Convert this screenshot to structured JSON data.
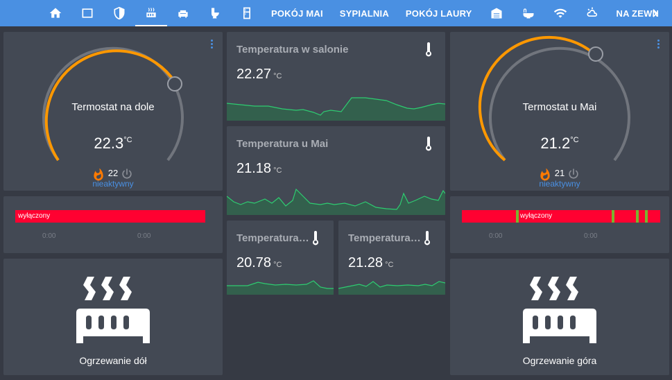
{
  "nav": {
    "tabs": [
      {
        "icon": "home-icon"
      },
      {
        "icon": "tv-icon"
      },
      {
        "icon": "shield-icon"
      },
      {
        "icon": "radiator-icon",
        "active": true
      },
      {
        "icon": "sofa-icon"
      },
      {
        "icon": "toilet-icon"
      },
      {
        "icon": "fridge-icon"
      }
    ],
    "text_tabs": [
      "POKÓJ MAI",
      "SYPIALNIA",
      "POKÓJ LAURY"
    ],
    "icon_tabs2": [
      {
        "icon": "garage-icon"
      },
      {
        "icon": "bathtub-icon"
      },
      {
        "icon": "wifi-icon"
      },
      {
        "icon": "weather-icon"
      }
    ],
    "last_tab": "NA ZEWN",
    "more_icon": "chevron-right-icon"
  },
  "thermostat_left": {
    "name": "Termostat na dole",
    "current": "22.3",
    "unit": "°C",
    "target": "22",
    "state": "nieaktywny",
    "heat_icon": "flame-icon",
    "power_icon": "power-icon",
    "accent": "#ff9800"
  },
  "thermostat_right": {
    "name": "Termostat u Mai",
    "current": "21.2",
    "unit": "°C",
    "target": "21",
    "state": "nieaktywny",
    "heat_icon": "flame-icon",
    "power_icon": "power-icon",
    "accent": "#ff9800"
  },
  "history_left": {
    "label": "wyłączony",
    "ticks": [
      "0:00",
      "0:00"
    ],
    "color": "#ff0131"
  },
  "history_right": {
    "label": "wyłączony",
    "ticks": [
      "0:00",
      "0:00"
    ],
    "color": "#ff0131",
    "on_color": "#7bb32e"
  },
  "heater_left": {
    "label": "Ogrzewanie dół",
    "icon": "radiator-icon"
  },
  "heater_right": {
    "label": "Ogrzewanie góra",
    "icon": "radiator-icon"
  },
  "sensors": {
    "salon": {
      "title": "Temperatura w salonie",
      "value": "22.27",
      "unit": "°C",
      "icon": "thermometer-icon"
    },
    "mai": {
      "title": "Temperatura u Mai",
      "value": "21.18",
      "unit": "°C",
      "icon": "thermometer-icon"
    },
    "small1": {
      "title": "Temperatura …",
      "value": "20.78",
      "unit": "°C",
      "icon": "thermometer-icon"
    },
    "small2": {
      "title": "Temperatura …",
      "value": "21.28",
      "unit": "°C",
      "icon": "thermometer-icon"
    }
  },
  "colors": {
    "accent": "#4a90e2",
    "card": "#434954",
    "background": "#363a44",
    "spark_line": "#2ecc71"
  }
}
